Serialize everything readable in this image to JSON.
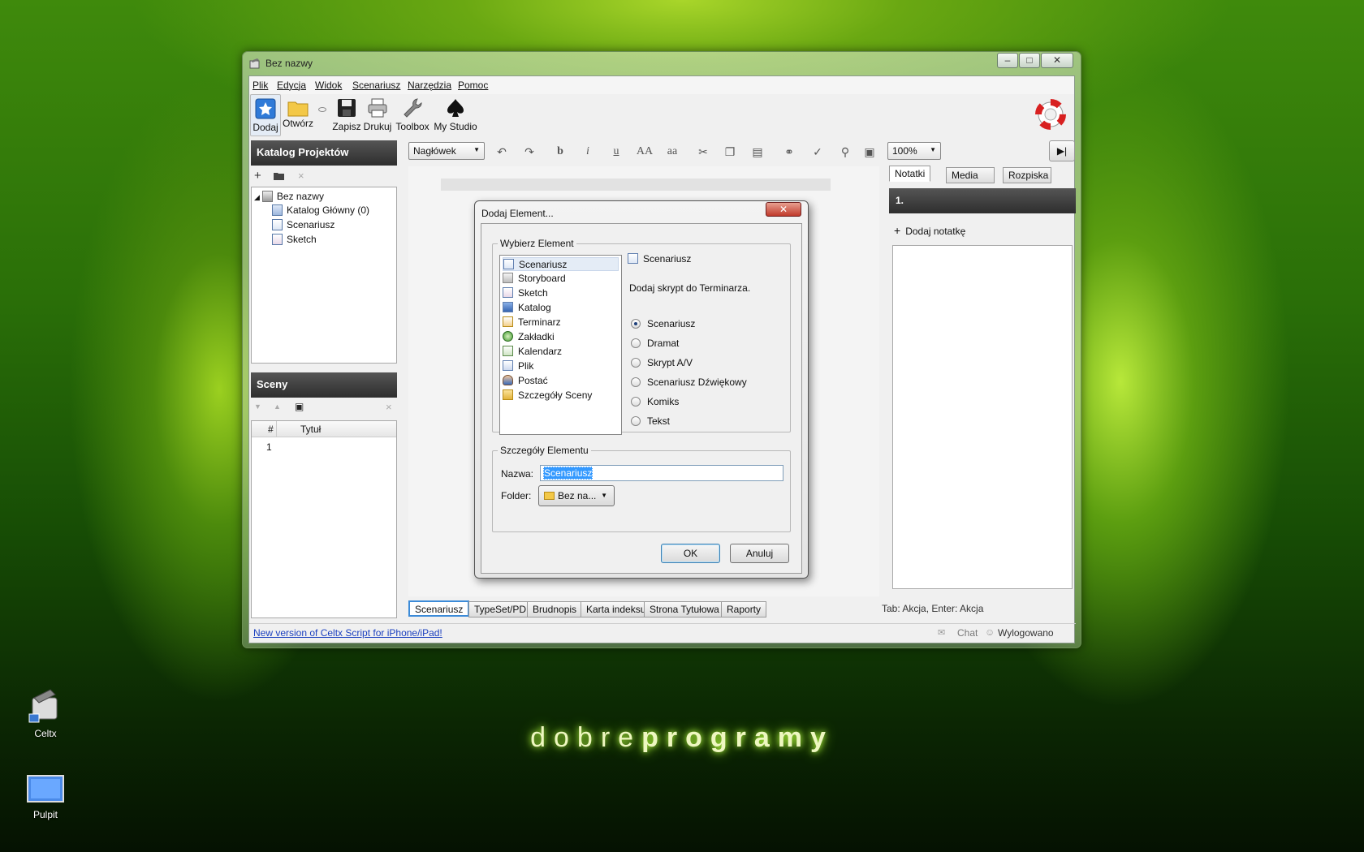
{
  "window": {
    "title": "Bez nazwy"
  },
  "menu": [
    "Plik",
    "Edycja",
    "Widok",
    "Scenariusz",
    "Narzędzia",
    "Pomoc"
  ],
  "toolbar": {
    "add": "Dodaj",
    "open": "Otwórz",
    "save": "Zapisz",
    "print": "Drukuj",
    "toolbox": "Toolbox",
    "studio": "My Studio"
  },
  "catalog": {
    "header": "Katalog Projektów",
    "tree": [
      {
        "label": "Bez nazwy"
      },
      {
        "label": "Katalog Główny (0)"
      },
      {
        "label": "Scenariusz"
      },
      {
        "label": "Sketch"
      }
    ]
  },
  "scenes": {
    "header": "Sceny",
    "col_num": "#",
    "col_title": "Tytuł",
    "rows": [
      {
        "num": "1",
        "title": ""
      }
    ]
  },
  "format": {
    "style": "Nagłówek",
    "bold": "b",
    "italic": "i",
    "underline": "u",
    "upper": "AA",
    "lower": "aa",
    "zoom": "100%"
  },
  "bottom_tabs": [
    "Scenariusz",
    "TypeSet/PDF",
    "Brudnopis",
    "Karta indeksu",
    "Strona Tytułowa",
    "Raporty"
  ],
  "status": {
    "hint": "Tab: Akcja, Enter: Akcja",
    "link": "New version of Celtx Script for iPhone/iPad!",
    "chat": "Chat",
    "login": "Wylogowano"
  },
  "notes": {
    "tabs": [
      "Notatki",
      "Media",
      "Rozpiska"
    ],
    "number": "1.",
    "add": "Dodaj notatkę"
  },
  "dialog": {
    "title": "Dodaj Element...",
    "group_select": "Wybierz Element",
    "items": [
      "Scenariusz",
      "Storyboard",
      "Sketch",
      "Katalog",
      "Terminarz",
      "Zakładki",
      "Kalendarz",
      "Plik",
      "Postać",
      "Szczegóły Sceny"
    ],
    "selected_label": "Scenariusz",
    "description": "Dodaj skrypt do Terminarza.",
    "radios": [
      "Scenariusz",
      "Dramat",
      "Skrypt A/V",
      "Scenariusz Dźwiękowy",
      "Komiks",
      "Tekst"
    ],
    "group_details": "Szczegóły Elementu",
    "name_label": "Nazwa:",
    "name_value": "Scenariusz",
    "folder_label": "Folder:",
    "folder_value": "Bez na...",
    "ok": "OK",
    "cancel": "Anuluj"
  },
  "desktop": {
    "icon1": "Celtx",
    "icon2": "Pulpit",
    "brand_light": "dobre",
    "brand_bold": "programy"
  },
  "colors": {
    "accent": "#3c8bd8",
    "link": "#1a3fbf",
    "panel_header": "#3a3a3a"
  }
}
